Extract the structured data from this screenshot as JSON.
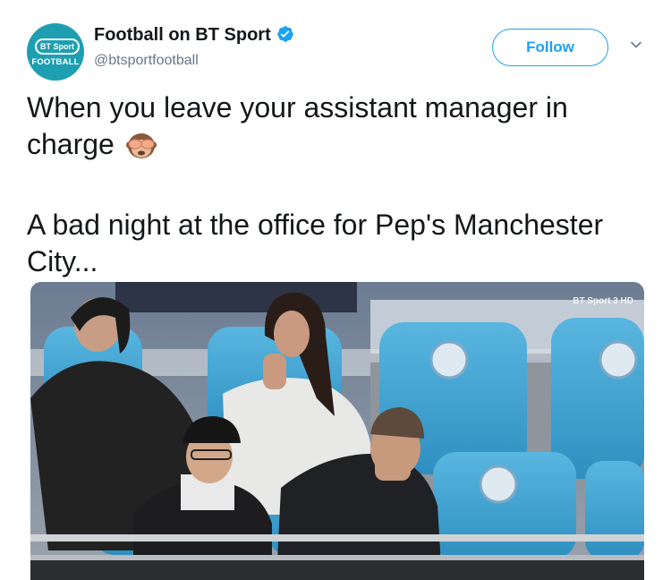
{
  "account": {
    "avatar_text_top": "BT Sport",
    "avatar_text_bottom": "FOOTBALL",
    "display_name": "Football on BT Sport",
    "handle": "@btsportfootball",
    "verified": true
  },
  "actions": {
    "follow_label": "Follow",
    "menu_icon": "chevron-down-icon"
  },
  "tweet": {
    "line1": "When you leave your assistant manager in charge",
    "emoji": "see-no-evil-monkey",
    "line2": "A bad night at the office for Pep's Manchester City..."
  },
  "media": {
    "watermark": "BT Sport 3 HD"
  },
  "colors": {
    "accent": "#1da1f2",
    "verified": "#1da1f2",
    "avatar_bg": "#1e9fb1",
    "text": "#14171a",
    "secondary": "#657786",
    "seat_blue": "#3ea7d6"
  }
}
